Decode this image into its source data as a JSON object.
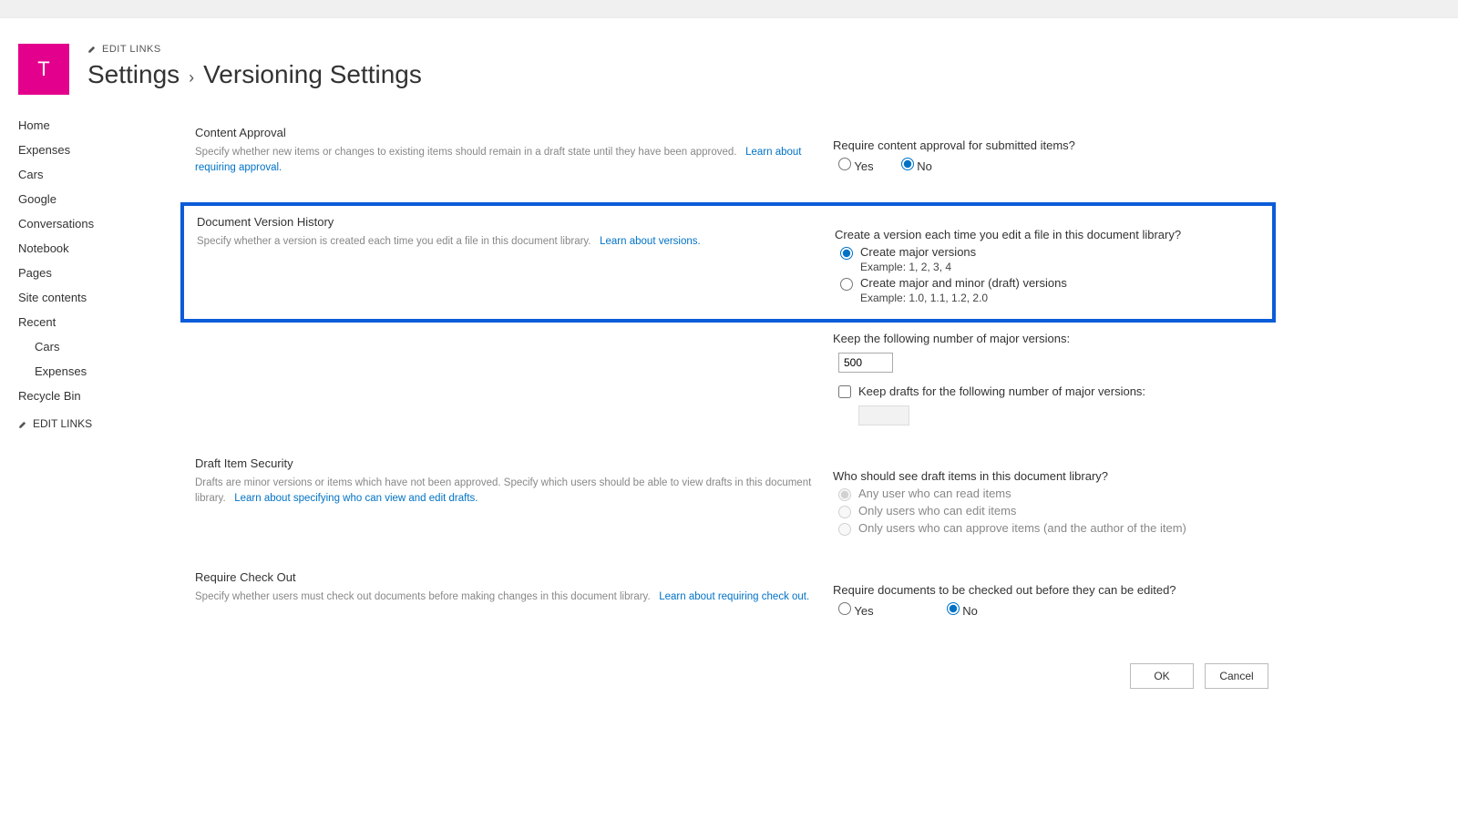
{
  "site": {
    "tile_letter": "T",
    "edit_links_label": "EDIT LINKS"
  },
  "breadcrumb": {
    "parent": "Settings",
    "sep": "›",
    "current": "Versioning Settings"
  },
  "sidebar": {
    "items": [
      {
        "label": "Home"
      },
      {
        "label": "Expenses"
      },
      {
        "label": "Cars"
      },
      {
        "label": "Google"
      },
      {
        "label": "Conversations"
      },
      {
        "label": "Notebook"
      },
      {
        "label": "Pages"
      },
      {
        "label": "Site contents"
      },
      {
        "label": "Recent"
      },
      {
        "label": "Cars",
        "sub": true
      },
      {
        "label": "Expenses",
        "sub": true
      },
      {
        "label": "Recycle Bin"
      }
    ],
    "edit_links_label": "EDIT LINKS"
  },
  "sections": {
    "content_approval": {
      "title": "Content Approval",
      "desc": "Specify whether new items or changes to existing items should remain in a draft state until they have been approved.",
      "learn_link": "Learn about requiring approval.",
      "question": "Require content approval for submitted items?",
      "yes": "Yes",
      "no": "No"
    },
    "version_history": {
      "title": "Document Version History",
      "desc": "Specify whether a version is created each time you edit a file in this document library.",
      "learn_link": "Learn about versions.",
      "question": "Create a version each time you edit a file in this document library?",
      "opt_major": "Create major versions",
      "ex_major": "Example: 1, 2, 3, 4",
      "opt_minor": "Create major and minor (draft) versions",
      "ex_minor": "Example: 1.0, 1.1, 1.2, 2.0",
      "keep_major_label": "Keep the following number of major versions:",
      "keep_major_value": "500",
      "keep_drafts_label": "Keep drafts for the following number of major versions:"
    },
    "draft_security": {
      "title": "Draft Item Security",
      "desc": "Drafts are minor versions or items which have not been approved. Specify which users should be able to view drafts in this document library.",
      "learn_link": "Learn about specifying who can view and edit drafts.",
      "question": "Who should see draft items in this document library?",
      "opt_read": "Any user who can read items",
      "opt_edit": "Only users who can edit items",
      "opt_approve": "Only users who can approve items (and the author of the item)"
    },
    "checkout": {
      "title": "Require Check Out",
      "desc": "Specify whether users must check out documents before making changes in this document library.",
      "learn_link": "Learn about requiring check out.",
      "question": "Require documents to be checked out before they can be edited?",
      "yes": "Yes",
      "no": "No"
    }
  },
  "buttons": {
    "ok": "OK",
    "cancel": "Cancel"
  }
}
